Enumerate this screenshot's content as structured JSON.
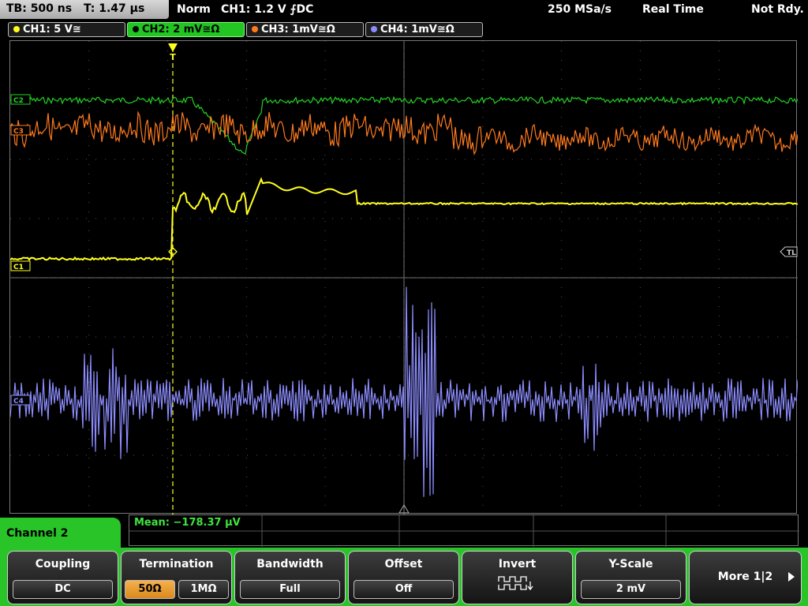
{
  "top_bar": {
    "timebase": "TB: 500 ns",
    "trigger_time": "T: 1.47 µs",
    "trigger_mode": "Norm",
    "trigger_info": "CH1: 1.2 V ⨍DC",
    "sample_rate": "250 MSa/s",
    "acq_mode": "Real Time",
    "status": "Not Rdy."
  },
  "channels": [
    {
      "label": "CH1: 5 V≅",
      "color": "#ffff1e"
    },
    {
      "label": "CH2: 2 mV≅Ω",
      "color": "#22d422"
    },
    {
      "label": "CH3: 1mV≅Ω",
      "color": "#ff7a1e"
    },
    {
      "label": "CH4: 1mV≅Ω",
      "color": "#8c8cff"
    }
  ],
  "markers": {
    "trigger": "T",
    "ch1": "C1",
    "ch2": "C2",
    "ch3": "C3",
    "ch4": "C4",
    "trigger_level": "TL"
  },
  "measurement": {
    "mean": "Mean: −178.37 µV"
  },
  "menu": {
    "title": "Channel 2",
    "coupling": {
      "title": "Coupling",
      "value": "DC"
    },
    "termination": {
      "title": "Termination",
      "option_a": "50Ω",
      "option_b": "1MΩ"
    },
    "bandwidth": {
      "title": "Bandwidth",
      "value": "Full"
    },
    "offset": {
      "title": "Offset",
      "value": "Off"
    },
    "invert": {
      "title": "Invert",
      "icon": "invert-square-wave-icon"
    },
    "yscale": {
      "title": "Y-Scale",
      "value": "2 mV"
    },
    "more": {
      "label": "More 1|2",
      "icon": "play-arrow-icon"
    }
  }
}
